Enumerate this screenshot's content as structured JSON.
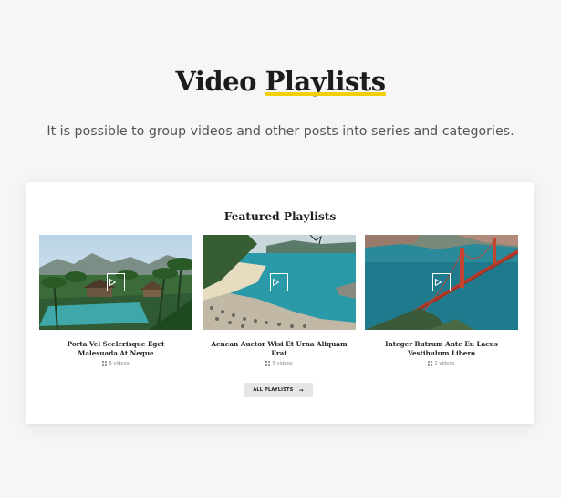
{
  "hero": {
    "title_plain": "Video",
    "title_highlight": "Playlists",
    "subtitle": "It is possible to group videos and other posts into series and categories."
  },
  "featured": {
    "title": "Featured Playlists",
    "playlists": [
      {
        "name": "Porta Vel Scelerisque Eget Malesuada At Neque",
        "count": "6 videos"
      },
      {
        "name": "Aenean Auctor Wisi Et Urna Aliquam Erat",
        "count": "5 videos"
      },
      {
        "name": "Integer Rutrum Ante Eu Lacus Vestibulum Libero",
        "count": "2 videos"
      }
    ],
    "button_label": "ALL PLAYLISTS",
    "button_arrow": "→"
  },
  "colors": {
    "highlight": "#f2cf0d",
    "background": "#f6f6f6",
    "card": "#ffffff",
    "button": "#e6e6e6"
  }
}
